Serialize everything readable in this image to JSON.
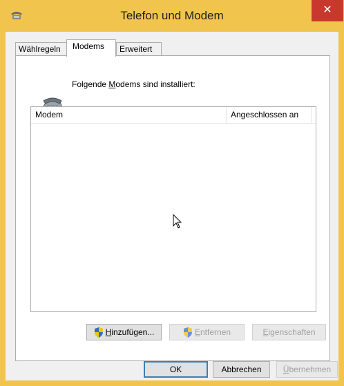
{
  "window": {
    "title": "Telefon und Modem",
    "close_glyph": "✕"
  },
  "tabs": [
    {
      "label": "Wählregeln",
      "active": false
    },
    {
      "label": "Modems",
      "active": true
    },
    {
      "label": "Erweitert",
      "active": false
    }
  ],
  "panel": {
    "intro_prefix": "Folgende ",
    "intro_mnemonic": "M",
    "intro_suffix": "odems sind installiert:",
    "icon": "modem-phone-icon"
  },
  "list": {
    "columns": [
      {
        "label": "Modem"
      },
      {
        "label": "Angeschlossen an"
      }
    ],
    "rows": []
  },
  "panel_buttons": {
    "add": {
      "mnemonic": "H",
      "rest": "inzufügen...",
      "enabled": true,
      "icon": "uac-shield-icon"
    },
    "remove": {
      "mnemonic": "E",
      "rest": "ntfernen",
      "enabled": false,
      "icon": "uac-shield-icon"
    },
    "properties": {
      "mnemonic": "E",
      "rest": "igenschaften",
      "enabled": false
    }
  },
  "dialog_buttons": {
    "ok": "OK",
    "cancel": "Abbrechen",
    "apply": {
      "mnemonic": "Ü",
      "rest": "bernehmen",
      "enabled": false
    }
  },
  "colors": {
    "window_frame": "#f0c44d",
    "close_button": "#c9382c",
    "client_bg": "#f0f0f0",
    "border": "#adadad",
    "disabled_text": "#a0a0a0"
  }
}
